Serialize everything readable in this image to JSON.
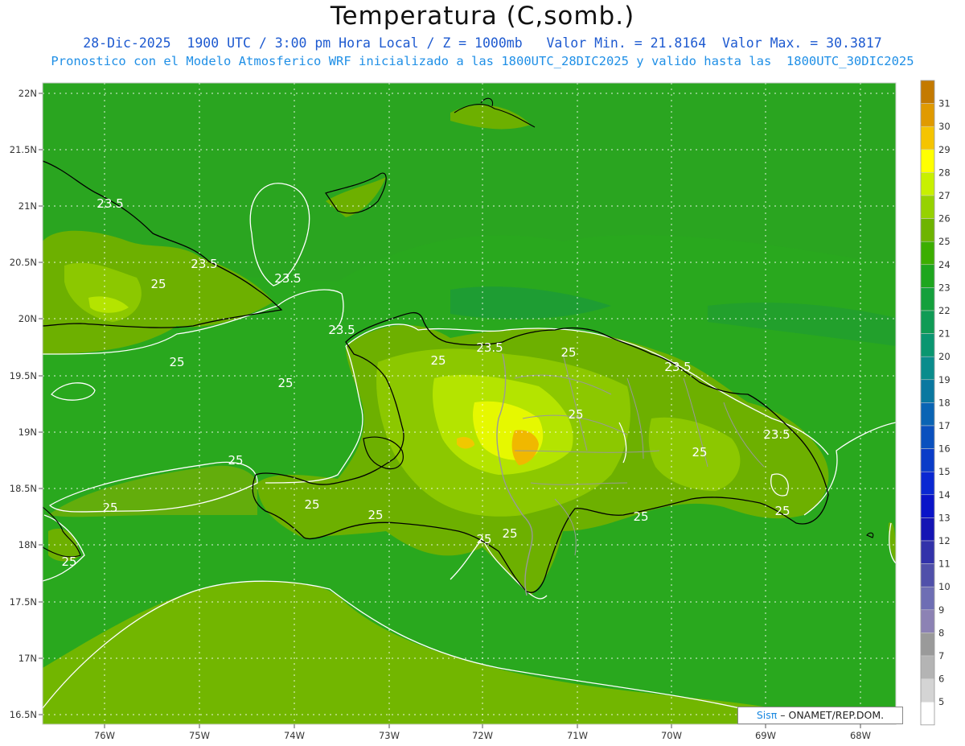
{
  "header": {
    "title": "Temperatura (C,somb.)",
    "subtitle1": "28-Dic-2025  1900 UTC / 3:00 pm Hora Local / Z = 1000mb   Valor Min. = 21.8164  Valor Max. = 30.3817",
    "subtitle2": "Pronostico con el Modelo Atmosferico WRF inicializado a las 1800UTC_28DIC2025 y valido hasta las  1800UTC_30DIC2025"
  },
  "map": {
    "lat_ticks": [
      "22N",
      "21.5N",
      "21N",
      "20.5N",
      "20N",
      "19.5N",
      "19N",
      "18.5N",
      "18N",
      "17.5N",
      "17N",
      "16.5N"
    ],
    "lon_ticks": [
      "76W",
      "75W",
      "74W",
      "73W",
      "72W",
      "71W",
      "70W",
      "69W",
      "68W"
    ],
    "contour_labels": [
      {
        "text": "23.5"
      },
      {
        "text": "23.5"
      },
      {
        "text": "23.5"
      },
      {
        "text": "23.5"
      },
      {
        "text": "23.5"
      },
      {
        "text": "23.5"
      },
      {
        "text": "23.5"
      },
      {
        "text": "25"
      },
      {
        "text": "25"
      },
      {
        "text": "25"
      },
      {
        "text": "25"
      },
      {
        "text": "25"
      },
      {
        "text": "25"
      },
      {
        "text": "25"
      },
      {
        "text": "25"
      },
      {
        "text": "25"
      },
      {
        "text": "25"
      },
      {
        "text": "25"
      },
      {
        "text": "25"
      },
      {
        "text": "25"
      },
      {
        "text": "25"
      },
      {
        "text": "25"
      },
      {
        "text": "25"
      }
    ]
  },
  "colorbar": {
    "levels": [
      {
        "label": "31",
        "color": "#c47a00"
      },
      {
        "label": "30",
        "color": "#e09a00"
      },
      {
        "label": "29",
        "color": "#f5c400"
      },
      {
        "label": "28",
        "color": "#ffff00"
      },
      {
        "label": "27",
        "color": "#c8f000"
      },
      {
        "label": "26",
        "color": "#96d200"
      },
      {
        "label": "25",
        "color": "#6eb400"
      },
      {
        "label": "24",
        "color": "#3cae00"
      },
      {
        "label": "23",
        "color": "#1ea61e"
      },
      {
        "label": "22",
        "color": "#14a03c"
      },
      {
        "label": "21",
        "color": "#0f9b55"
      },
      {
        "label": "20",
        "color": "#0a9670"
      },
      {
        "label": "19",
        "color": "#0a8c8c"
      },
      {
        "label": "18",
        "color": "#0a78a0"
      },
      {
        "label": "17",
        "color": "#0a64b4"
      },
      {
        "label": "16",
        "color": "#0a50be"
      },
      {
        "label": "15",
        "color": "#0a3cc8"
      },
      {
        "label": "14",
        "color": "#0a28d2"
      },
      {
        "label": "13",
        "color": "#0a14c8"
      },
      {
        "label": "12",
        "color": "#1414b4"
      },
      {
        "label": "11",
        "color": "#3232aa"
      },
      {
        "label": "10",
        "color": "#5050aa"
      },
      {
        "label": "9",
        "color": "#6e6eb4"
      },
      {
        "label": "8",
        "color": "#8c82b4"
      },
      {
        "label": "7",
        "color": "#9a9a9a"
      },
      {
        "label": "6",
        "color": "#b4b4b4"
      },
      {
        "label": "5",
        "color": "#d4d4d4"
      },
      {
        "label": "",
        "color": "#ffffff"
      }
    ]
  },
  "credit": {
    "sis": "Sisπ",
    "text": " –  ONAMET/REP.DOM."
  }
}
